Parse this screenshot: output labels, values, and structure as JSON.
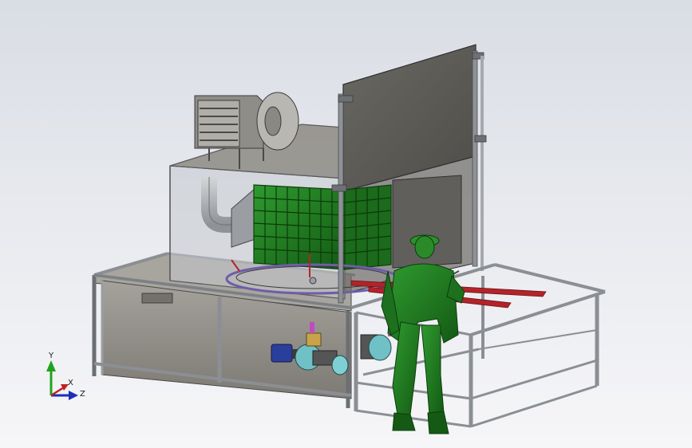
{
  "viewport": {
    "background_top": "#d9dde4",
    "background_bottom": "#f6f6f8"
  },
  "colors": {
    "frame_steel": "#9a9ea3",
    "frame_dark": "#55595d",
    "panel_dark": "#5c5a55",
    "tank_body": "#8d8a84",
    "glass": "#c9ced4",
    "operator_green": "#1f7a1f",
    "filter_green": "#2c7a2c",
    "rail_red": "#b4232a",
    "pump_blue": "#2a3f9c",
    "pump_cyan": "#6fc1c6",
    "duct_grey": "#b7babd"
  },
  "icons": [
    "coordinate-triad-icon"
  ],
  "triad": {
    "y_label": "Y",
    "x_label": "X",
    "z_label": "Z"
  }
}
